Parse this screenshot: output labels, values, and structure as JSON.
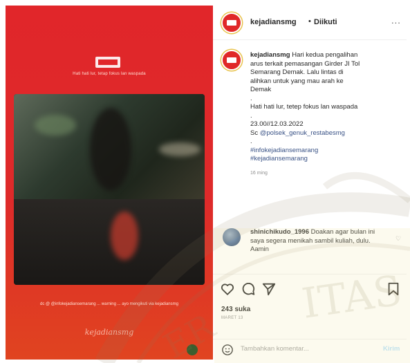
{
  "media": {
    "logo_text": "JADIAN",
    "top_text": "Hati hati lur, tetap fokus lan waspada",
    "video_caption": "",
    "bottom_text": "dc @ @infokejadiansemarang ... warning ... ayo mengikuti via kejadiansmg",
    "signature": "kejadiansmg"
  },
  "post_header": {
    "username": "kejadiansmg",
    "separator": "•",
    "follow_status": "Diikuti",
    "more_label": "..."
  },
  "caption": {
    "username": "kejadiansmg",
    "text_lines": [
      "Hari kedua pengalihan",
      "arus terkait pemasangan Girder JI Tol",
      "Semarang Demak. Lalu lintas di",
      "alihkan untuk yang mau arah ke",
      "Demak"
    ],
    "dot1": ".",
    "line2": "Hati hati lur, tetep fokus lan waspada",
    "dot2": ".",
    "datetime": "23.00//12.03.2022",
    "source_prefix": "Sc ",
    "source_handle": "@polsek_genuk_restabesmg",
    "dot3": ".",
    "hashtag1": "#infokejadiansemarang",
    "hashtag2": "#kejadiansemarang",
    "time_ago": "16 ming"
  },
  "comment": {
    "username": "shinichikudo_1996",
    "text": "Doakan agar bulan ini saya segera menikah sambil kuliah, dulu. Aamin"
  },
  "actions": {
    "likes": "243 suka",
    "date": "MARET 13"
  },
  "add_comment": {
    "placeholder": "Tambahkan komentar...",
    "post_label": "Kirim"
  },
  "watermark": {
    "text": "ITAS",
    "text2": "ER"
  },
  "colors": {
    "brand_red": "#e1262a",
    "link_blue": "#385185",
    "post_button": "#b2dffc"
  }
}
